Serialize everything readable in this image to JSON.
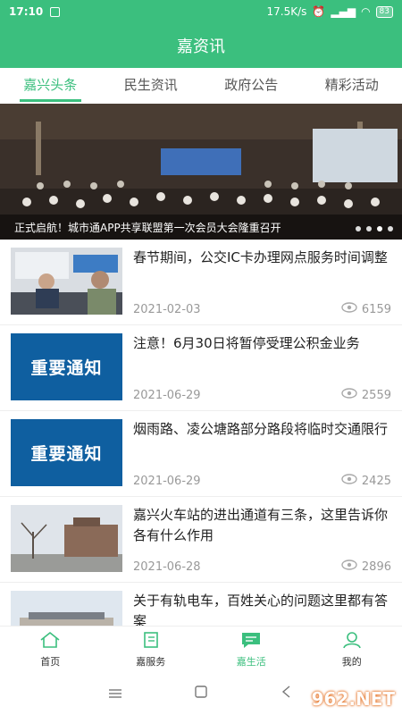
{
  "status": {
    "time": "17:10",
    "net_speed": "17.5K/s",
    "battery": "83"
  },
  "app": {
    "title": "嘉资讯"
  },
  "tabs": [
    {
      "label": "嘉兴头条"
    },
    {
      "label": "民生资讯"
    },
    {
      "label": "政府公告"
    },
    {
      "label": "精彩活动"
    }
  ],
  "banner": {
    "caption": "正式启航！城市通APP共享联盟第一次会员大会隆重召开"
  },
  "articles": [
    {
      "title": "春节期间，公交IC卡办理网点服务时间调整",
      "date": "2021-02-03",
      "views": "6159",
      "thumb": "office-photo"
    },
    {
      "title": "注意！6月30日将暂停受理公积金业务",
      "date": "2021-06-29",
      "views": "2559",
      "thumb": "notice",
      "thumb_text": "重要通知"
    },
    {
      "title": "烟雨路、凌公塘路部分路段将临时交通限行",
      "date": "2021-06-29",
      "views": "2425",
      "thumb": "notice",
      "thumb_text": "重要通知"
    },
    {
      "title": "嘉兴火车站的进出通道有三条，这里告诉你各有什么作用",
      "date": "2021-06-28",
      "views": "2896",
      "thumb": "station-photo"
    },
    {
      "title": "关于有轨电车，百姓关心的问题这里都有答案",
      "date": "",
      "views": "",
      "thumb": "building-photo"
    }
  ],
  "nav": [
    {
      "label": "首页",
      "icon": "home-icon"
    },
    {
      "label": "嘉服务",
      "icon": "service-icon"
    },
    {
      "label": "嘉生活",
      "icon": "chat-icon"
    },
    {
      "label": "我的",
      "icon": "profile-icon"
    }
  ],
  "watermark": "962.NET",
  "colors": {
    "primary": "#3bbf7e",
    "notice_blue": "#0f5fa0"
  }
}
